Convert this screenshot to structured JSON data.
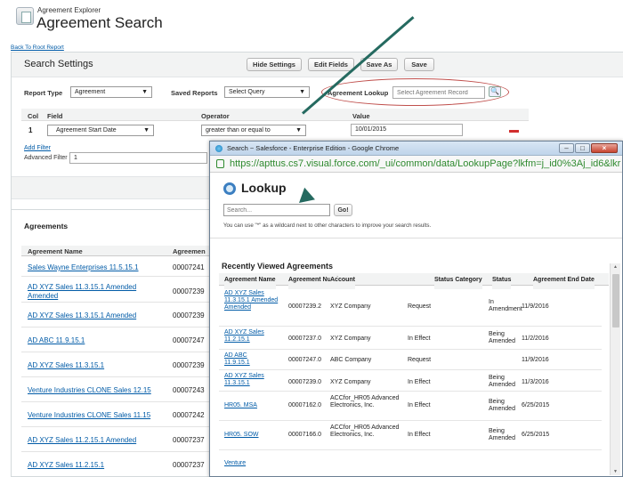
{
  "header": {
    "app": "Agreement Explorer",
    "title": "Agreement Search",
    "back_link": "Back To Root Report"
  },
  "search_settings": {
    "title": "Search Settings",
    "buttons": [
      "Hide Settings",
      "Edit Fields",
      "Save As",
      "Save"
    ],
    "report_type_label": "Report Type",
    "report_type_value": "Agreement",
    "saved_reports_label": "Saved Reports",
    "saved_reports_value": "Select Query",
    "agreement_lookup_label": "Agreement Lookup",
    "agreement_lookup_placeholder": "Select Agreement Record",
    "columns": [
      "Col",
      "Field",
      "Operator",
      "Value"
    ],
    "row": {
      "col": "1",
      "field": "Agreement Start Date",
      "operator": "greater than or equal to",
      "value": "10/01/2015"
    },
    "add_filter": "Add Filter",
    "advanced_filter_label": "Advanced Filter",
    "advanced_filter_value": "1"
  },
  "agreements": {
    "title": "Agreements",
    "col_name": "Agreement Name",
    "col_number": "Agreemen",
    "rows": [
      {
        "name": "Sales Wayne Enterprises 11.5.15.1",
        "number": "00007241"
      },
      {
        "name": "AD XYZ Sales 11.3.15.1 Amended",
        "name2": "Amended",
        "number": "00007239"
      },
      {
        "name": "AD XYZ Sales 11.3.15.1 Amended",
        "number": "00007239"
      },
      {
        "name": "AD ABC 11.9.15.1",
        "number": "00007247"
      },
      {
        "name": "AD XYZ Sales 11.3.15.1",
        "number": "00007239"
      },
      {
        "name": "Venture Industries CLONE Sales 12.15",
        "number": "00007243"
      },
      {
        "name": "Venture Industries CLONE Sales 11.15",
        "number": "00007242"
      },
      {
        "name": "AD XYZ Sales 11.2.15.1 Amended",
        "number": "00007237"
      },
      {
        "name": "AD XYZ Sales 11.2.15.1",
        "number": "00007237"
      }
    ]
  },
  "popup": {
    "window_title": "Search ~ Salesforce - Enterprise Edition - Google Chrome",
    "url": "https://apttus.cs7.visual.force.com/_ui/common/data/LookupPage?lkfm=j_id0%3Aj_id6&lkr",
    "lookup_title": "Lookup",
    "search_placeholder": "Search...",
    "go_label": "Go!",
    "hint": "You can use \"*\" as a wildcard next to other characters to improve your search results.",
    "recent_title": "Recently Viewed Agreements",
    "columns": [
      "Agreement Name",
      "Agreement Number",
      "Account",
      "Status Category",
      "Status",
      "Agreement End Date"
    ],
    "rows": [
      {
        "name": "AD XYZ Sales 11.3.15.1 Amended Amended",
        "number": "00007239.2",
        "account": "XYZ Company",
        "category": "Request",
        "status": "In Amendment",
        "end": "11/9/2016"
      },
      {
        "name": "AD XYZ Sales 11.2.15.1",
        "number": "00007237.0",
        "account": "XYZ Company",
        "category": "In Effect",
        "status": "Being Amended",
        "end": "11/2/2016"
      },
      {
        "name": "AD ABC 11.9.15.1",
        "number": "00007247.0",
        "account": "ABC Company",
        "category": "Request",
        "status": "",
        "end": "11/9/2016"
      },
      {
        "name": "AD XYZ Sales 11.3.15.1",
        "number": "00007239.0",
        "account": "XYZ Company",
        "category": "In Effect",
        "status": "Being Amended",
        "end": "11/3/2016"
      },
      {
        "name": "HR05. MSA",
        "number": "00007162.0",
        "account": "ACCfor_HR05 Advanced Electronics, Inc.",
        "category": "In Effect",
        "status": "Being Amended",
        "end": "6/25/2015"
      },
      {
        "name": "HR05. SOW",
        "number": "00007166.0",
        "account": "ACCfor_HR05 Advanced Electronics, Inc.",
        "category": "In Effect",
        "status": "Being Amended",
        "end": "6/25/2015"
      },
      {
        "name": "Venture",
        "number": "",
        "account": "",
        "category": "",
        "status": "",
        "end": ""
      }
    ]
  },
  "colors": {
    "link": "#015ba7",
    "annotation": "#c0504d",
    "arrow": "#256a60"
  }
}
